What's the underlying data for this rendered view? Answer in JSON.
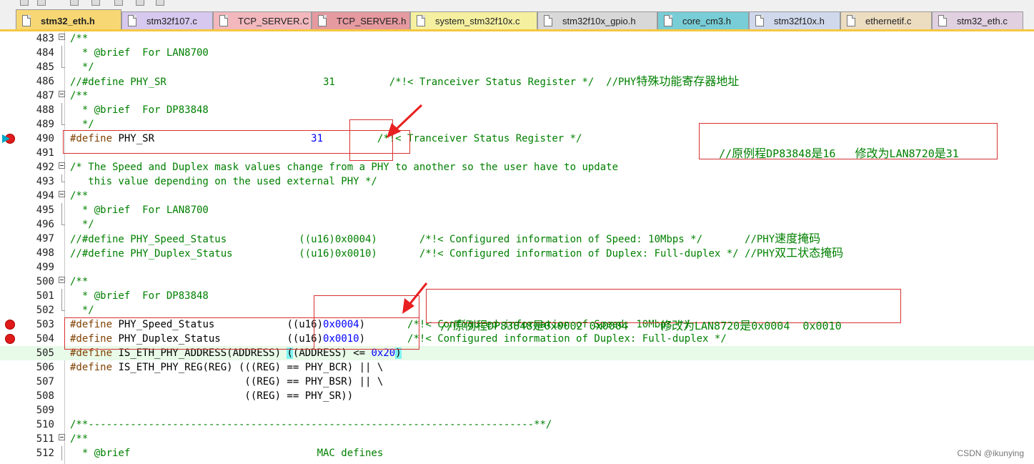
{
  "tabs": [
    {
      "label": "stm32_eth.h",
      "color": "#f7d774",
      "active": true
    },
    {
      "label": "stm32f107.c",
      "color": "#d6c8ee",
      "active": false
    },
    {
      "label": "TCP_SERVER.C",
      "color": "#f2b8bd",
      "active": false
    },
    {
      "label": "TCP_SERVER.h",
      "color": "#e59aa0",
      "active": false
    },
    {
      "label": "system_stm32f10x.c",
      "color": "#f5f0a0",
      "active": false
    },
    {
      "label": "stm32f10x_gpio.h",
      "color": "#d8d8d8",
      "active": false
    },
    {
      "label": "core_cm3.h",
      "color": "#78cdd6",
      "active": false
    },
    {
      "label": "stm32f10x.h",
      "color": "#d0d8ec",
      "active": false
    },
    {
      "label": "ethernetif.c",
      "color": "#ecdcc0",
      "active": false
    },
    {
      "label": "stm32_eth.c",
      "color": "#e0d0e0",
      "active": false
    }
  ],
  "lines": [
    {
      "n": "483",
      "fold": "start",
      "parts": [
        {
          "t": "/**",
          "c": "com"
        }
      ]
    },
    {
      "n": "484",
      "fold": "mid",
      "parts": [
        {
          "t": "  * @brief  For LAN8700",
          "c": "com"
        }
      ]
    },
    {
      "n": "485",
      "fold": "end",
      "parts": [
        {
          "t": "  */",
          "c": "com"
        }
      ]
    },
    {
      "n": "486",
      "fold": "",
      "parts": [
        {
          "t": "//#define PHY_SR                          31         /*!< Tranceiver Status Register */  //PHY",
          "c": "com"
        },
        {
          "t": "特殊功能寄存器地址",
          "c": "comcn"
        }
      ]
    },
    {
      "n": "487",
      "fold": "start",
      "parts": [
        {
          "t": "/**",
          "c": "com"
        }
      ]
    },
    {
      "n": "488",
      "fold": "mid",
      "parts": [
        {
          "t": "  * @brief  For DP83848",
          "c": "com"
        }
      ]
    },
    {
      "n": "489",
      "fold": "end",
      "parts": [
        {
          "t": "  */",
          "c": "com"
        }
      ]
    },
    {
      "n": "490",
      "fold": "",
      "mark": "bp-arrow",
      "parts": [
        {
          "t": "#define",
          "c": "pre"
        },
        {
          "t": " PHY_SR                          ",
          "c": ""
        },
        {
          "t": "31",
          "c": "num"
        },
        {
          "t": "         ",
          "c": ""
        },
        {
          "t": "/*!< Tranceiver Status Register */",
          "c": "com"
        }
      ]
    },
    {
      "n": "491",
      "fold": "",
      "parts": []
    },
    {
      "n": "492",
      "fold": "start",
      "parts": [
        {
          "t": "/* The Speed and Duplex mask values change from a PHY to another so the user have to update",
          "c": "com"
        }
      ]
    },
    {
      "n": "493",
      "fold": "end",
      "parts": [
        {
          "t": "   this value depending on the used external PHY */",
          "c": "com"
        }
      ]
    },
    {
      "n": "494",
      "fold": "start",
      "parts": [
        {
          "t": "/**",
          "c": "com"
        }
      ]
    },
    {
      "n": "495",
      "fold": "mid",
      "parts": [
        {
          "t": "  * @brief  For LAN8700",
          "c": "com"
        }
      ]
    },
    {
      "n": "496",
      "fold": "end",
      "parts": [
        {
          "t": "  */",
          "c": "com"
        }
      ]
    },
    {
      "n": "497",
      "fold": "",
      "parts": [
        {
          "t": "//#define PHY_Speed_Status            ((u16)0x0004)       /*!< Configured information of Speed: 10Mbps */       //PHY",
          "c": "com"
        },
        {
          "t": "速度掩码",
          "c": "comcn"
        }
      ]
    },
    {
      "n": "498",
      "fold": "",
      "parts": [
        {
          "t": "//#define PHY_Duplex_Status           ((u16)0x0010)       /*!< Configured information of Duplex: Full-duplex */ //PHY",
          "c": "com"
        },
        {
          "t": "双工状态掩码",
          "c": "comcn"
        }
      ]
    },
    {
      "n": "499",
      "fold": "",
      "parts": []
    },
    {
      "n": "500",
      "fold": "start",
      "parts": [
        {
          "t": "/**",
          "c": "com"
        }
      ]
    },
    {
      "n": "501",
      "fold": "mid",
      "parts": [
        {
          "t": "  * @brief  For DP83848",
          "c": "com"
        }
      ]
    },
    {
      "n": "502",
      "fold": "end",
      "parts": [
        {
          "t": "  */",
          "c": "com"
        }
      ]
    },
    {
      "n": "503",
      "fold": "",
      "mark": "bp",
      "parts": [
        {
          "t": "#define",
          "c": "pre"
        },
        {
          "t": " PHY_Speed_Status            ((u16)",
          "c": ""
        },
        {
          "t": "0x0004",
          "c": "num"
        },
        {
          "t": ")       ",
          "c": ""
        },
        {
          "t": "/*!< Configured information of Speed: 10Mbps */",
          "c": "com"
        }
      ]
    },
    {
      "n": "504",
      "fold": "",
      "mark": "bp",
      "parts": [
        {
          "t": "#define",
          "c": "pre"
        },
        {
          "t": " PHY_Duplex_Status           ((u16)",
          "c": ""
        },
        {
          "t": "0x0010",
          "c": "num"
        },
        {
          "t": ")       ",
          "c": ""
        },
        {
          "t": "/*!< Configured information of Duplex: Full-duplex */",
          "c": "com"
        }
      ]
    },
    {
      "n": "505",
      "fold": "",
      "current": true,
      "parts": [
        {
          "t": "#define",
          "c": "pre"
        },
        {
          "t": " IS_ETH_PHY_ADDRESS(ADDRESS) ",
          "c": ""
        },
        {
          "t": "(",
          "c": "brace"
        },
        {
          "t": "(ADDRESS) <= ",
          "c": ""
        },
        {
          "t": "0x20",
          "c": "num"
        },
        {
          "t": ")",
          "c": "brace"
        }
      ]
    },
    {
      "n": "506",
      "fold": "",
      "parts": [
        {
          "t": "#define",
          "c": "pre"
        },
        {
          "t": " IS_ETH_PHY_REG(REG) (((REG) == PHY_BCR) || \\",
          "c": ""
        }
      ]
    },
    {
      "n": "507",
      "fold": "",
      "parts": [
        {
          "t": "                             ((REG) == PHY_BSR) || \\",
          "c": ""
        }
      ]
    },
    {
      "n": "508",
      "fold": "",
      "parts": [
        {
          "t": "                             ((REG) == PHY_SR))",
          "c": ""
        }
      ]
    },
    {
      "n": "509",
      "fold": "",
      "parts": []
    },
    {
      "n": "510",
      "fold": "",
      "parts": [
        {
          "t": "/**--------------------------------------------------------------------------**/",
          "c": "com"
        }
      ]
    },
    {
      "n": "511",
      "fold": "start",
      "parts": [
        {
          "t": "/**",
          "c": "com"
        }
      ]
    },
    {
      "n": "512",
      "fold": "mid",
      "parts": [
        {
          "t": "  * @brief                               MAC defines",
          "c": "com"
        }
      ]
    }
  ],
  "annotations": {
    "note1": {
      "prefix": "//",
      "cn1": "原例程",
      "mid": "DP83848",
      "cn2": "是",
      "val": "16   ",
      "cn3": "修改为",
      "mid2": "LAN8720",
      "cn4": "是",
      "val2": "31"
    },
    "note2": {
      "prefix": "//",
      "cn1": "原例程",
      "mid": "DP83848",
      "cn2": "是",
      "val": "0x0002 0x0004     ",
      "cn3": "修改为",
      "mid2": "LAN8720",
      "cn4": "是",
      "val2": "0x0004  0x0010"
    }
  },
  "watermark": "CSDN @ikunying",
  "colors": {
    "comment": "#008000",
    "preprocessor": "#804000",
    "number": "#0000ff",
    "annotation_red": "#d83030",
    "current_line": "#e8fae8"
  }
}
